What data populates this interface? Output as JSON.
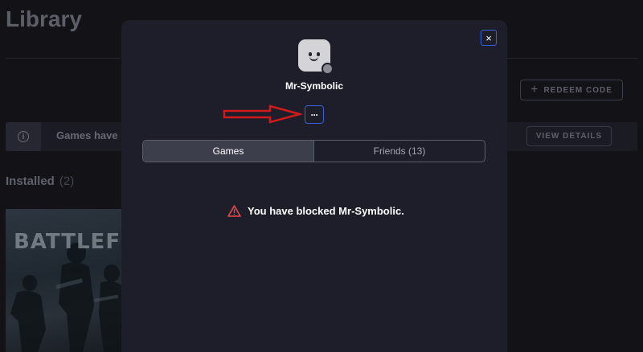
{
  "library": {
    "title": "Library",
    "redeem_label": "REDEEM CODE",
    "banner_text": "Games have (",
    "view_details_label": "VIEW DETAILS",
    "installed_label": "Installed",
    "installed_count": "(2)",
    "game_tile_art_text": "BATTLEFIEL"
  },
  "modal": {
    "username": "Mr-Symbolic",
    "more_label": "···",
    "close_label": "×",
    "tabs": [
      {
        "label": "Games",
        "active": true
      },
      {
        "label": "Friends (13)",
        "active": false
      }
    ],
    "blocked_message": "You have blocked Mr-Symbolic.",
    "avatar_status": "offline"
  },
  "colors": {
    "accent": "#3b5fd6",
    "annotation_arrow": "#d11a1a",
    "warning": "#e5484d",
    "modal_bg": "#1d1e2a",
    "page_bg": "#121217"
  },
  "icons": {
    "close": "close-icon",
    "more": "more-dots-icon",
    "info": "info-icon",
    "warning": "warning-triangle-icon",
    "plus": "plus-icon"
  }
}
